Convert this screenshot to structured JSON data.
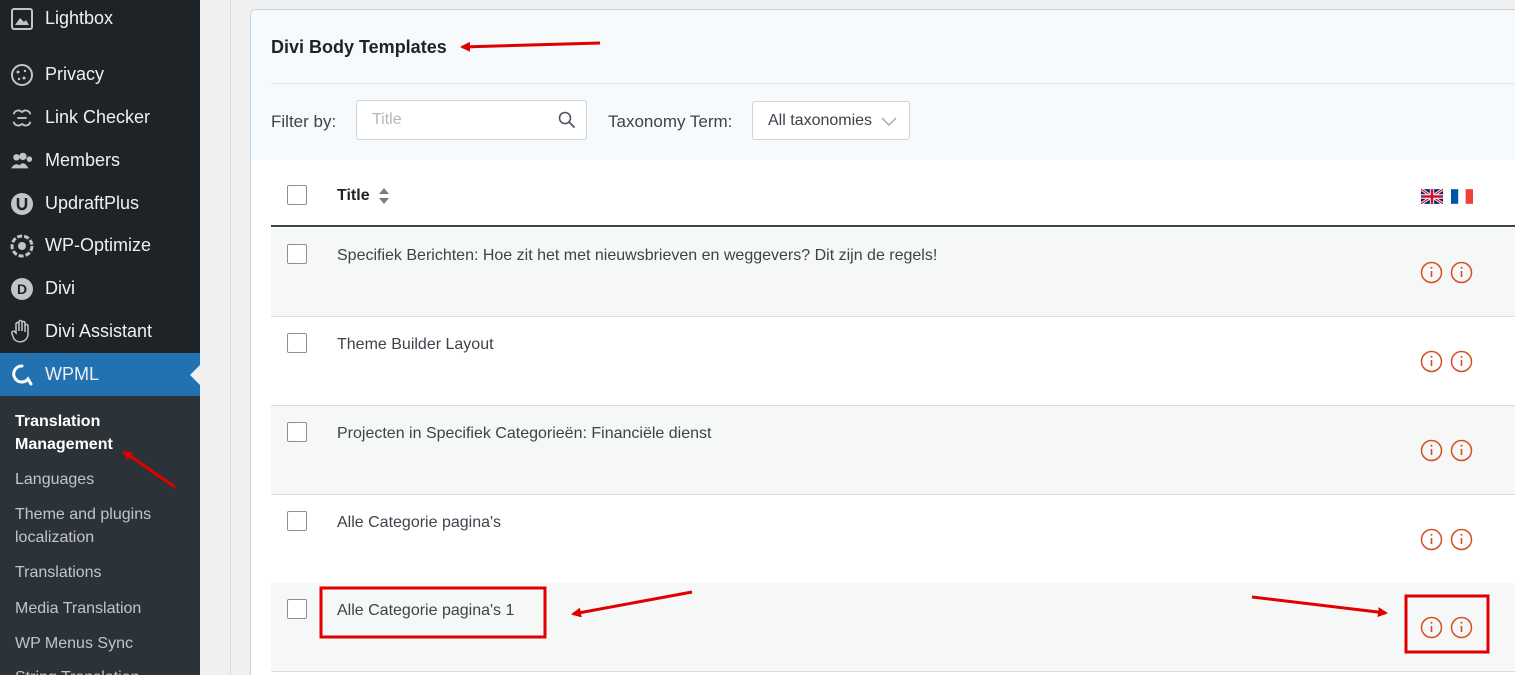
{
  "sidebar": {
    "items": [
      {
        "label": "Lightbox",
        "icon": "image-icon"
      },
      {
        "label": "Privacy",
        "icon": "cookie-icon"
      },
      {
        "label": "Link Checker",
        "icon": "link-checker-icon"
      },
      {
        "label": "Members",
        "icon": "members-icon"
      },
      {
        "label": "UpdraftPlus",
        "icon": "updraftplus-icon"
      },
      {
        "label": "WP-Optimize",
        "icon": "wp-optimize-icon"
      },
      {
        "label": "Divi",
        "icon": "divi-icon"
      },
      {
        "label": "Divi Assistant",
        "icon": "hand-icon"
      },
      {
        "label": "WPML",
        "icon": "wpml-icon"
      }
    ],
    "submenu": [
      {
        "label": "Translation Management"
      },
      {
        "label": "Languages"
      },
      {
        "label": "Theme and plugins localization"
      },
      {
        "label": "Translations"
      },
      {
        "label": "Media Translation"
      },
      {
        "label": "WP Menus Sync"
      },
      {
        "label": "String Translation"
      }
    ]
  },
  "panel": {
    "title": "Divi Body Templates",
    "filter_label": "Filter by:",
    "search_placeholder": "Title",
    "taxonomy_label": "Taxonomy Term:",
    "taxonomy_value": "All taxonomies"
  },
  "table": {
    "header_title": "Title",
    "languages": [
      "English",
      "French"
    ],
    "rows": [
      {
        "title": "Specifiek Berichten: Hoe zit het met nieuwsbrieven en weggevers? Dit zijn de regels!"
      },
      {
        "title": "Theme Builder Layout"
      },
      {
        "title": "Projecten in Specifiek Categorieën: Financiële dienst"
      },
      {
        "title": "Alle Categorie pagina's"
      },
      {
        "title": "Alle Categorie pagina's 1"
      }
    ]
  },
  "colors": {
    "sidebar_bg": "#1d2327",
    "active_bg": "#2271b1",
    "status_icon": "#d54e21",
    "annotation": "#e00000"
  }
}
